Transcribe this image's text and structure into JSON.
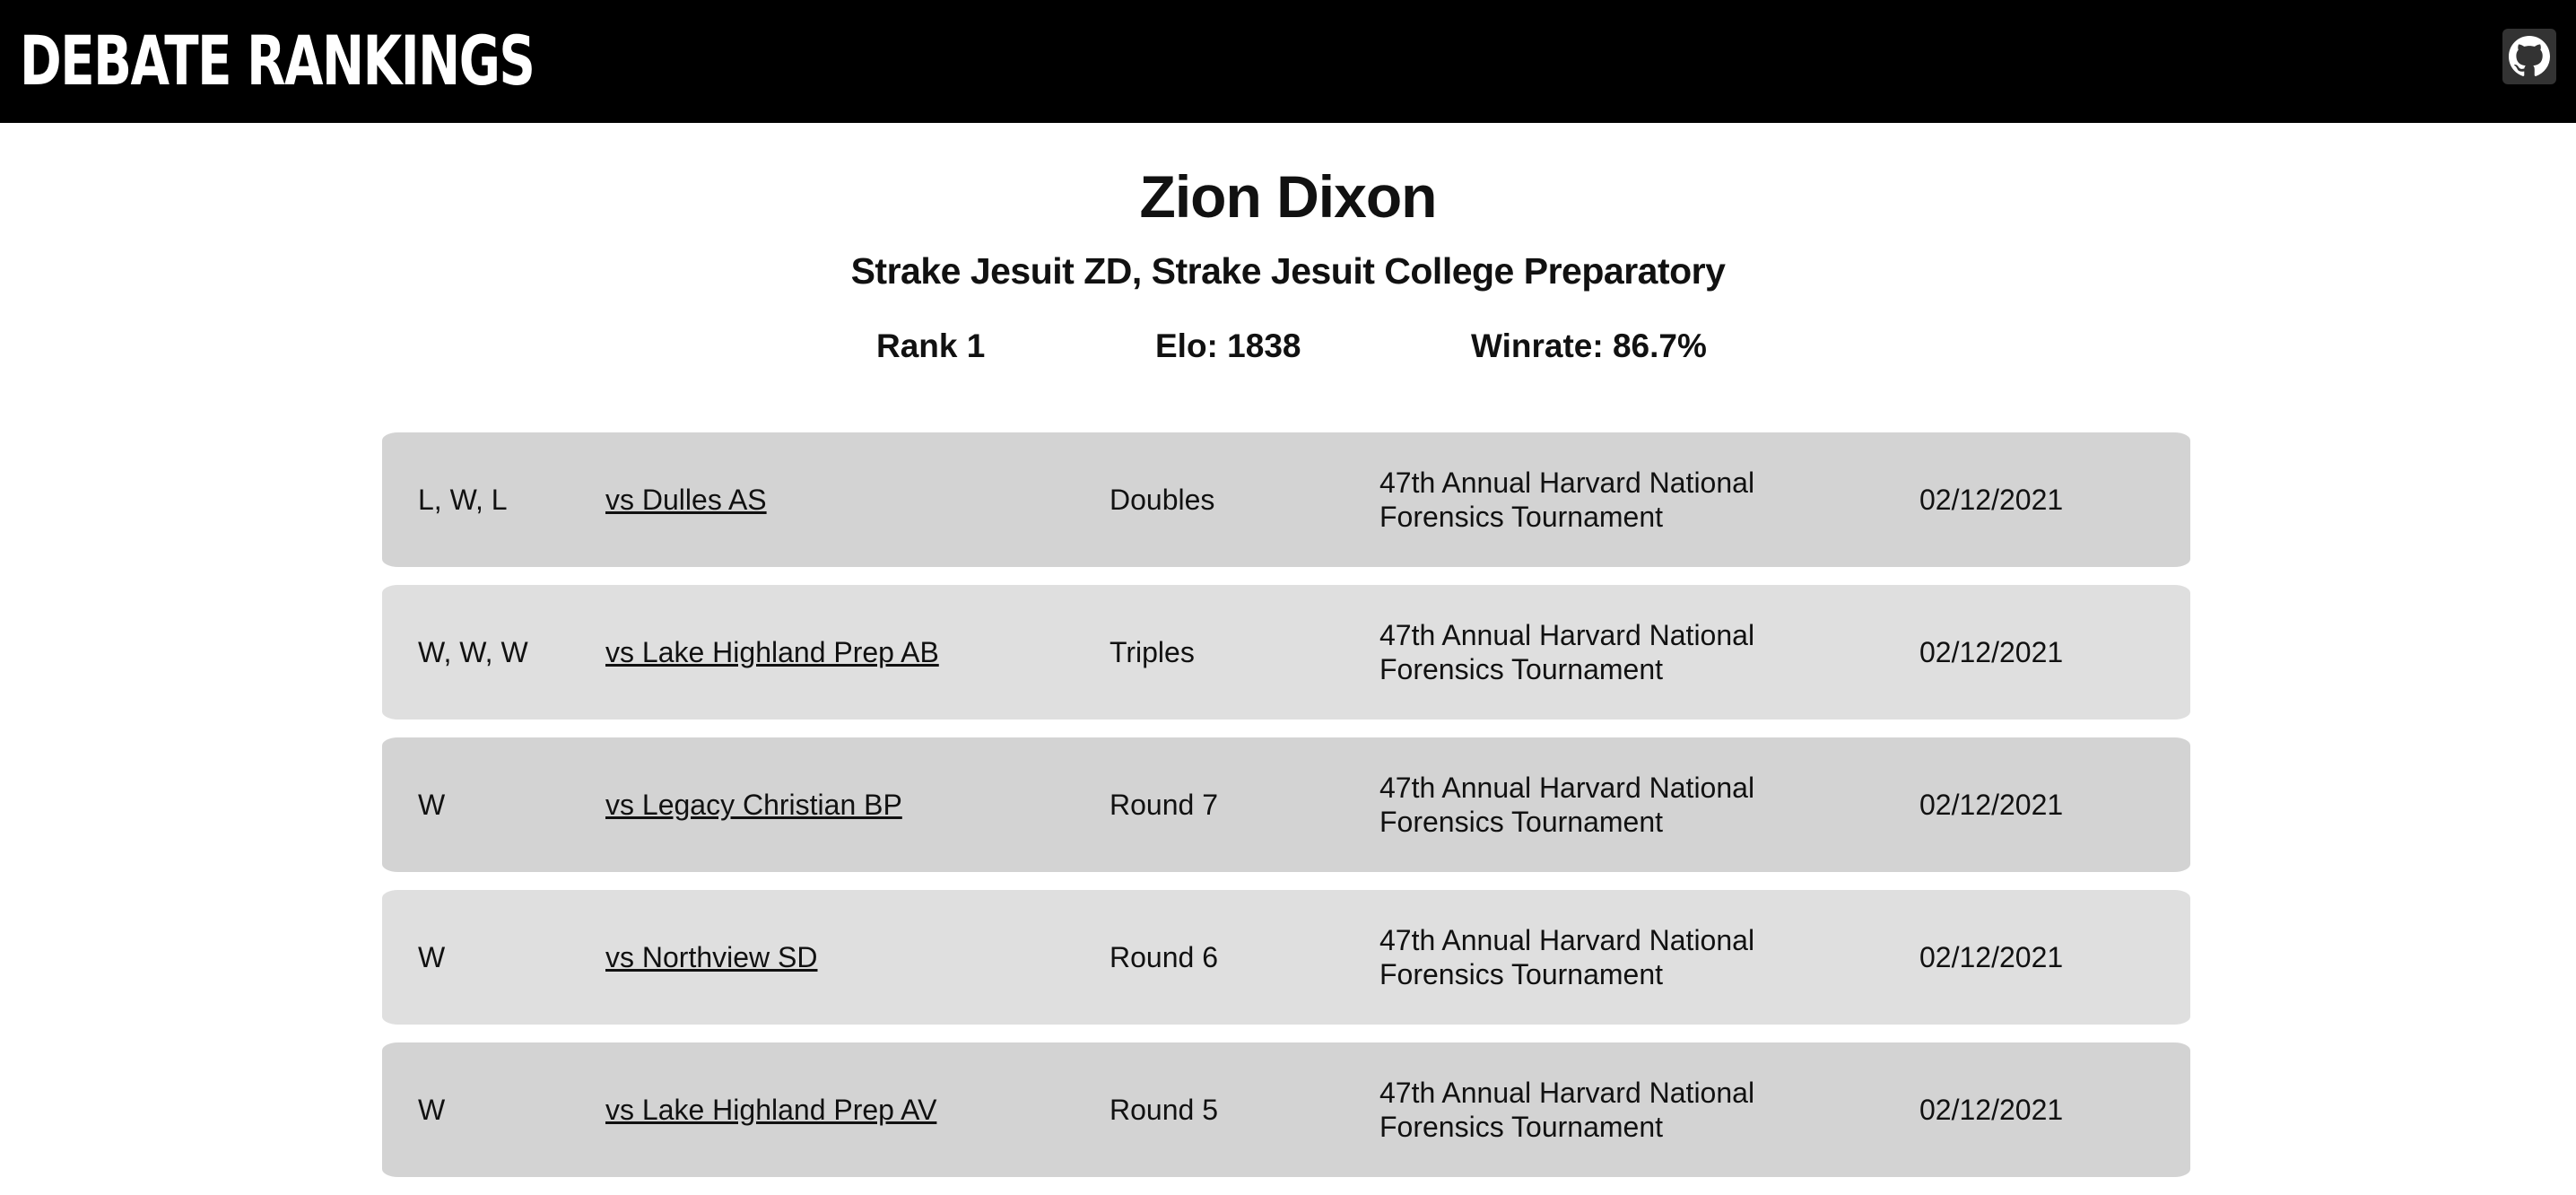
{
  "header": {
    "title": "DEBATE RANKINGS",
    "github_icon": "github-icon"
  },
  "profile": {
    "name": "Zion Dixon",
    "school": "Strake Jesuit ZD, Strake Jesuit College Preparatory",
    "rank": "Rank 1",
    "elo": "Elo: 1838",
    "winrate": "Winrate: 86.7%"
  },
  "rounds": [
    {
      "result": "L, W, L",
      "opponent": "vs Dulles AS",
      "round": "Doubles",
      "tournament": "47th Annual Harvard National Forensics Tournament",
      "date": "02/12/2021"
    },
    {
      "result": "W, W, W",
      "opponent": "vs Lake Highland Prep AB",
      "round": "Triples",
      "tournament": "47th Annual Harvard National Forensics Tournament",
      "date": "02/12/2021"
    },
    {
      "result": "W",
      "opponent": "vs Legacy Christian BP",
      "round": "Round 7",
      "tournament": "47th Annual Harvard National Forensics Tournament",
      "date": "02/12/2021"
    },
    {
      "result": "W",
      "opponent": "vs Northview SD",
      "round": "Round 6",
      "tournament": "47th Annual Harvard National Forensics Tournament",
      "date": "02/12/2021"
    },
    {
      "result": "W",
      "opponent": "vs Lake Highland Prep AV",
      "round": "Round 5",
      "tournament": "47th Annual Harvard National Forensics Tournament",
      "date": "02/12/2021"
    }
  ]
}
